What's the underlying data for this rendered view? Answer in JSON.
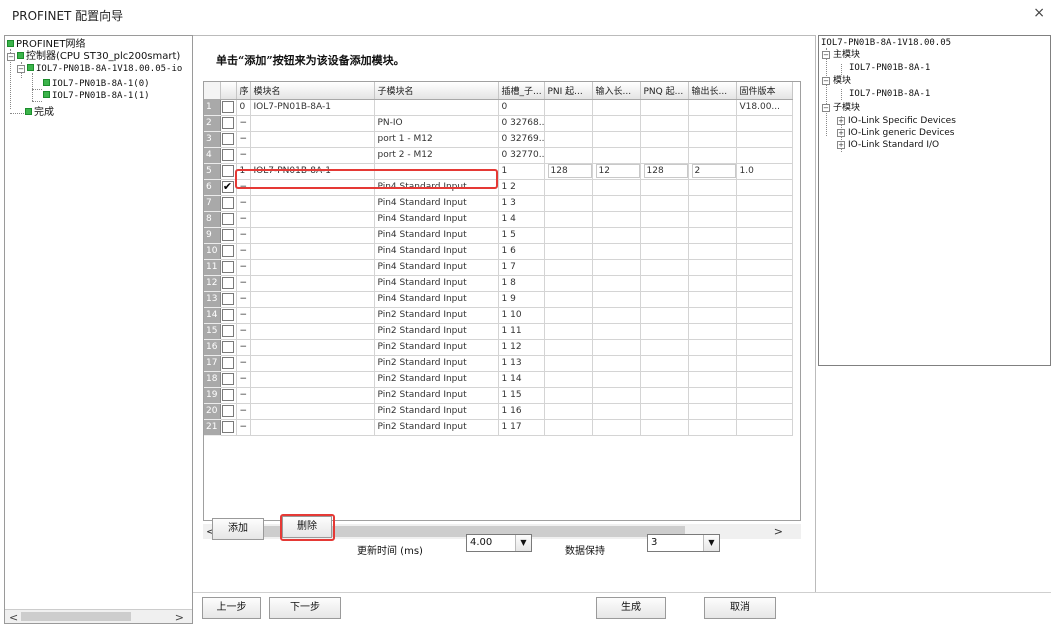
{
  "window": {
    "title": "PROFINET 配置向导",
    "close": "×"
  },
  "tree": {
    "root": "PROFINET网络",
    "controller": "控制器(CPU ST30_plc200smart)",
    "device": "IOL7-PN01B-8A-1V18.00.05-io",
    "children": [
      "IOL7-PN01B-8A-1(0)",
      "IOL7-PN01B-8A-1(1)"
    ],
    "done": "完成",
    "expand_minus": "−"
  },
  "instruction": "单击“添加”按钮来为该设备添加模块。",
  "table": {
    "headers": [
      "序",
      "模块名",
      "子模块名",
      "插槽_子...",
      "PNI 起...",
      "输入长...",
      "PNQ 起...",
      "输出长...",
      "固件版本"
    ],
    "rows": [
      {
        "n": "1",
        "checked": false,
        "seq": "0",
        "module": "IOL7-PN01B-8A-1",
        "sub": "",
        "slot": "0",
        "pni": "",
        "inlen": "",
        "pnq": "",
        "outlen": "",
        "fw": "V18.00..."
      },
      {
        "n": "2",
        "checked": false,
        "seq": "−",
        "module": "",
        "sub": "PN-IO",
        "slot": "0 32768...",
        "pni": "",
        "inlen": "",
        "pnq": "",
        "outlen": "",
        "fw": ""
      },
      {
        "n": "3",
        "checked": false,
        "seq": "−",
        "module": "",
        "sub": "port 1 - M12",
        "slot": "0 32769...",
        "pni": "",
        "inlen": "",
        "pnq": "",
        "outlen": "",
        "fw": ""
      },
      {
        "n": "4",
        "checked": false,
        "seq": "−",
        "module": "",
        "sub": "port 2 - M12",
        "slot": "0 32770...",
        "pni": "",
        "inlen": "",
        "pnq": "",
        "outlen": "",
        "fw": ""
      },
      {
        "n": "5",
        "checked": false,
        "seq": "1",
        "module": "IOL7-PN01B-8A-1",
        "sub": "",
        "slot": "1",
        "pni": "128",
        "inlen": "12",
        "pnq": "128",
        "outlen": "2",
        "fw": "1.0"
      },
      {
        "n": "6",
        "checked": true,
        "seq": "−",
        "module": "",
        "sub": "Pin4 Standard Input",
        "slot": "1 2",
        "pni": "",
        "inlen": "",
        "pnq": "",
        "outlen": "",
        "fw": ""
      },
      {
        "n": "7",
        "checked": false,
        "seq": "−",
        "module": "",
        "sub": "Pin4 Standard Input",
        "slot": "1 3",
        "pni": "",
        "inlen": "",
        "pnq": "",
        "outlen": "",
        "fw": ""
      },
      {
        "n": "8",
        "checked": false,
        "seq": "−",
        "module": "",
        "sub": "Pin4 Standard Input",
        "slot": "1 4",
        "pni": "",
        "inlen": "",
        "pnq": "",
        "outlen": "",
        "fw": ""
      },
      {
        "n": "9",
        "checked": false,
        "seq": "−",
        "module": "",
        "sub": "Pin4 Standard Input",
        "slot": "1 5",
        "pni": "",
        "inlen": "",
        "pnq": "",
        "outlen": "",
        "fw": ""
      },
      {
        "n": "10",
        "checked": false,
        "seq": "−",
        "module": "",
        "sub": "Pin4 Standard Input",
        "slot": "1 6",
        "pni": "",
        "inlen": "",
        "pnq": "",
        "outlen": "",
        "fw": ""
      },
      {
        "n": "11",
        "checked": false,
        "seq": "−",
        "module": "",
        "sub": "Pin4 Standard Input",
        "slot": "1 7",
        "pni": "",
        "inlen": "",
        "pnq": "",
        "outlen": "",
        "fw": ""
      },
      {
        "n": "12",
        "checked": false,
        "seq": "−",
        "module": "",
        "sub": "Pin4 Standard Input",
        "slot": "1 8",
        "pni": "",
        "inlen": "",
        "pnq": "",
        "outlen": "",
        "fw": ""
      },
      {
        "n": "13",
        "checked": false,
        "seq": "−",
        "module": "",
        "sub": "Pin4 Standard Input",
        "slot": "1 9",
        "pni": "",
        "inlen": "",
        "pnq": "",
        "outlen": "",
        "fw": ""
      },
      {
        "n": "14",
        "checked": false,
        "seq": "−",
        "module": "",
        "sub": "Pin2 Standard Input",
        "slot": "1 10",
        "pni": "",
        "inlen": "",
        "pnq": "",
        "outlen": "",
        "fw": ""
      },
      {
        "n": "15",
        "checked": false,
        "seq": "−",
        "module": "",
        "sub": "Pin2 Standard Input",
        "slot": "1 11",
        "pni": "",
        "inlen": "",
        "pnq": "",
        "outlen": "",
        "fw": ""
      },
      {
        "n": "16",
        "checked": false,
        "seq": "−",
        "module": "",
        "sub": "Pin2 Standard Input",
        "slot": "1 12",
        "pni": "",
        "inlen": "",
        "pnq": "",
        "outlen": "",
        "fw": ""
      },
      {
        "n": "17",
        "checked": false,
        "seq": "−",
        "module": "",
        "sub": "Pin2 Standard Input",
        "slot": "1 13",
        "pni": "",
        "inlen": "",
        "pnq": "",
        "outlen": "",
        "fw": ""
      },
      {
        "n": "18",
        "checked": false,
        "seq": "−",
        "module": "",
        "sub": "Pin2 Standard Input",
        "slot": "1 14",
        "pni": "",
        "inlen": "",
        "pnq": "",
        "outlen": "",
        "fw": ""
      },
      {
        "n": "19",
        "checked": false,
        "seq": "−",
        "module": "",
        "sub": "Pin2 Standard Input",
        "slot": "1 15",
        "pni": "",
        "inlen": "",
        "pnq": "",
        "outlen": "",
        "fw": ""
      },
      {
        "n": "20",
        "checked": false,
        "seq": "−",
        "module": "",
        "sub": "Pin2 Standard Input",
        "slot": "1 16",
        "pni": "",
        "inlen": "",
        "pnq": "",
        "outlen": "",
        "fw": ""
      },
      {
        "n": "21",
        "checked": false,
        "seq": "−",
        "module": "",
        "sub": "Pin2 Standard Input",
        "slot": "1 17",
        "pni": "",
        "inlen": "",
        "pnq": "",
        "outlen": "",
        "fw": ""
      }
    ]
  },
  "scroll": {
    "left_arrow": "<",
    "right_arrow": ">"
  },
  "actions": {
    "add": "添加",
    "delete": "删除",
    "update_time_label": "更新时间 (ms)",
    "update_time_value": "4.00",
    "data_hold_label": "数据保持",
    "data_hold_value": "3",
    "dropdown_glyph": "▼"
  },
  "footer": {
    "prev": "上一步",
    "next": "下一步",
    "generate": "生成",
    "cancel": "取消"
  },
  "right_tree": {
    "title": "IOL7-PN01B-8A-1V18.00.05",
    "main_module": "主模块",
    "main_module_item": "IOL7-PN01B-8A-1",
    "module": "模块",
    "module_item": "IOL7-PN01B-8A-1",
    "submodule": "子模块",
    "sub_items": [
      "IO-Link Specific Devices",
      "IO-Link generic Devices",
      "IO-Link Standard I/O"
    ],
    "minus": "−",
    "plus": "+"
  },
  "colors": {
    "highlight": "#e53935",
    "tree_node": "#3cb44b",
    "row_header": "#a9a9a9"
  }
}
